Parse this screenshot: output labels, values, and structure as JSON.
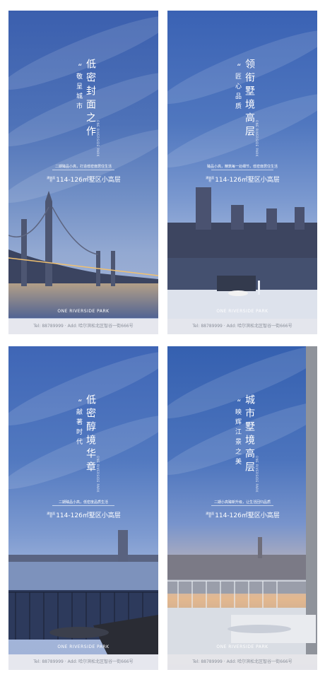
{
  "posters": [
    {
      "sub": "敬呈城市",
      "title": "低密封面之作",
      "tagline": "二期臻品小高，打造低密度居住生活",
      "area_label": "建筑面积",
      "area": "114-126㎡墅区小高层"
    },
    {
      "sub": "匠心品质",
      "title": "领衔墅境高层",
      "tagline": "臻品小高，精筑每一处细节，低密度居住生活",
      "area_label": "建筑面积",
      "area": "114-126㎡墅区小高层"
    },
    {
      "sub": "献著时代",
      "title": "低密醇境华章",
      "tagline": "二期臻品小高，低密度品质生活",
      "area_label": "建筑面积",
      "area": "114-126㎡墅区小高层"
    },
    {
      "sub": "映辉江景之美",
      "title": "城市墅境高层",
      "tagline": "二期小高臻新升级，让生活回归品质",
      "area_label": "建筑面积",
      "area": "114-126㎡墅区小高层"
    }
  ],
  "brand": "ONE RIVERSIDE PARK",
  "footer": "Tel: 88789999 · Add: 哈尔滨松北区智谷一街666号",
  "quote_mark": "“",
  "end_mark": "。",
  "vertical_en": "ONE RIVERSIDE PARK"
}
